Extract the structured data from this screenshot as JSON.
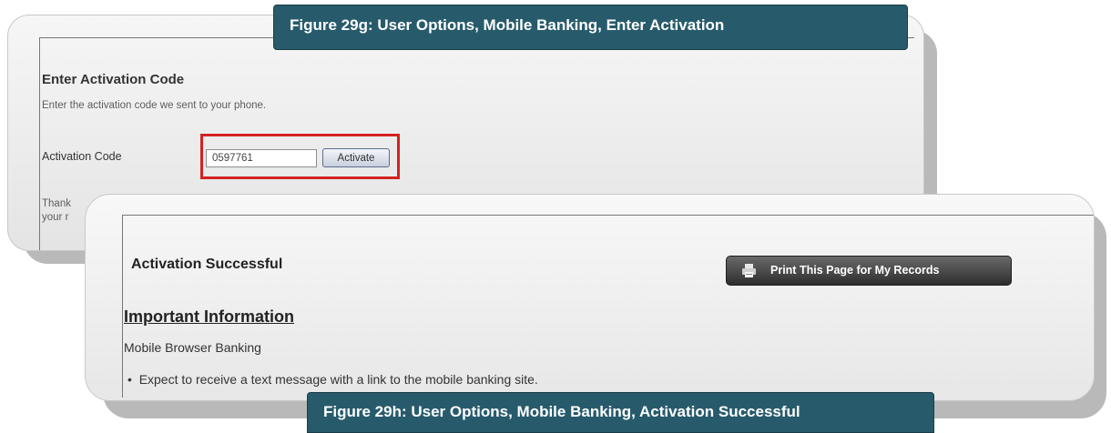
{
  "figure_top": {
    "caption": "Figure 29g: User Options, Mobile Banking, Enter Activation"
  },
  "activation": {
    "title": "Enter Activation Code",
    "instructions": "Enter the activation code we sent to your phone.",
    "code_label": "Activation Code",
    "code_value": "0597761",
    "activate_label": "Activate",
    "thank_you_line1": "Thank",
    "thank_you_line2": "your r",
    "highlight_color": "#d42222"
  },
  "success": {
    "title": "Activation Successful",
    "print_button_label": "Print This Page for My Records",
    "info_heading": "Important Information",
    "mobile_browser_banking": "Mobile Browser Banking",
    "bullet_1": "Expect to receive a text message with a link to the mobile banking site."
  },
  "figure_bottom": {
    "caption": "Figure 29h: User Options, Mobile Banking, Activation Successful"
  },
  "colors": {
    "caption_bg": "#275b6c",
    "print_button_bg": "#3a3a3a"
  },
  "icons": {
    "print": "printer-icon"
  }
}
